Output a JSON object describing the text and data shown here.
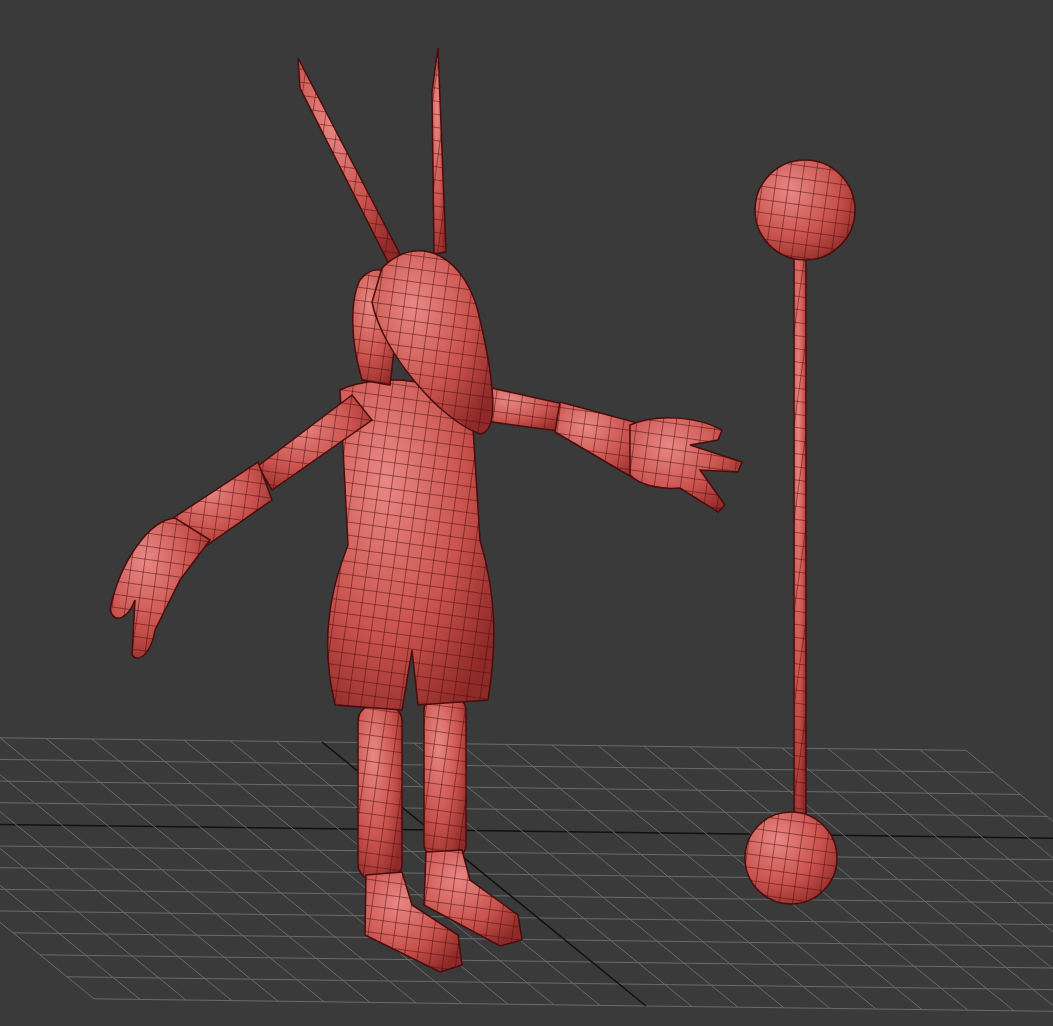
{
  "viewport": {
    "grid": true,
    "model": true,
    "staff": true
  }
}
